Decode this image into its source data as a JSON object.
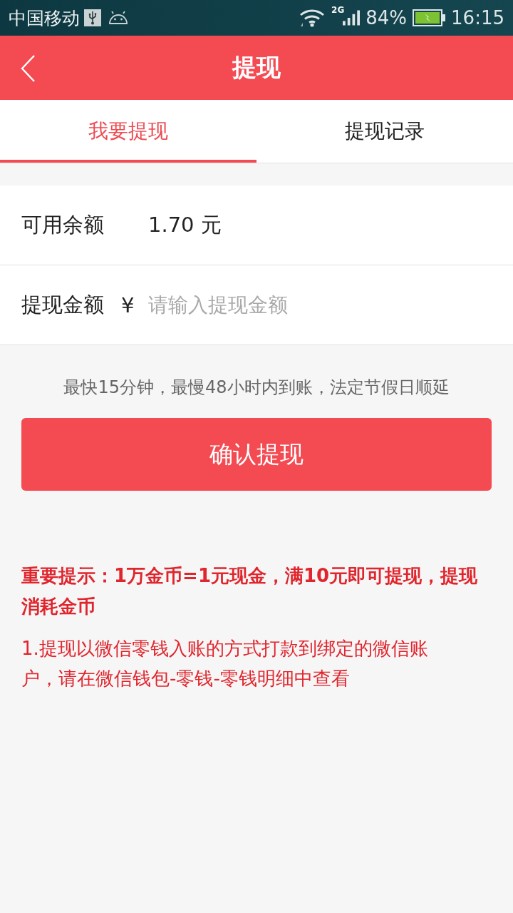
{
  "status_bar": {
    "carrier": "中国移动",
    "network": "2G",
    "battery": "84%",
    "time": "16:15"
  },
  "header": {
    "title": "提现"
  },
  "tabs": [
    {
      "label": "我要提现",
      "selected": true
    },
    {
      "label": "提现记录",
      "selected": false
    }
  ],
  "balance": {
    "label": "可用余额",
    "value": "1.70 元"
  },
  "amount": {
    "label": "提现金额",
    "currency": "¥",
    "placeholder": "请输入提现金额"
  },
  "note": "最快15分钟，最慢48小时内到账，法定节假日顺延",
  "confirm_button": "确认提现",
  "notice": {
    "title": "重要提示：1万金币=1元现金，满10元即可提现，提现消耗金币",
    "items": [
      "1.提现以微信零钱入账的方式打款到绑定的微信账户，请在微信钱包-零钱-零钱明细中查看"
    ]
  }
}
